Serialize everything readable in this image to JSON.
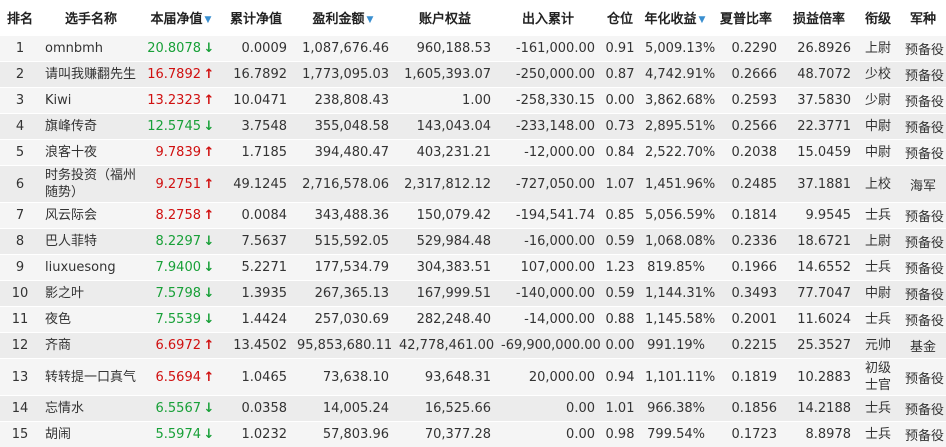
{
  "headers": [
    {
      "label": "排名",
      "sortable": false
    },
    {
      "label": "选手名称",
      "sortable": false
    },
    {
      "label": "本届净值",
      "sortable": true
    },
    {
      "label": "累计净值",
      "sortable": false
    },
    {
      "label": "盈利金额",
      "sortable": true
    },
    {
      "label": "账户权益",
      "sortable": false
    },
    {
      "label": "出入累计",
      "sortable": false
    },
    {
      "label": "仓位",
      "sortable": false
    },
    {
      "label": "年化收益",
      "sortable": true
    },
    {
      "label": "夏普比率",
      "sortable": false
    },
    {
      "label": "损益倍率",
      "sortable": false
    },
    {
      "label": "衔级",
      "sortable": false
    },
    {
      "label": "军种",
      "sortable": false
    }
  ],
  "sort_arrow_glyph": "▼",
  "colors": {
    "up": "#d01010",
    "down": "#18a038",
    "sort_arrow": "#3a8fd0"
  },
  "rows": [
    {
      "rank": "1",
      "name": "omnbmh",
      "nav": "20.8078",
      "dir": "down",
      "cum": "0.0009",
      "profit": "1,087,676.46",
      "equity": "960,188.53",
      "flow": "-161,000.00",
      "pos": "0.91",
      "annual": "5,009.13%",
      "sharpe": "0.2290",
      "pl": "26.8926",
      "rank_title": "上尉",
      "branch": "预备役"
    },
    {
      "rank": "2",
      "name": "请叫我赚翻先生",
      "nav": "16.7892",
      "dir": "up",
      "cum": "16.7892",
      "profit": "1,773,095.03",
      "equity": "1,605,393.07",
      "flow": "-250,000.00",
      "pos": "0.87",
      "annual": "4,742.91%",
      "sharpe": "0.2666",
      "pl": "48.7072",
      "rank_title": "少校",
      "branch": "预备役"
    },
    {
      "rank": "3",
      "name": "Kiwi",
      "nav": "13.2323",
      "dir": "up",
      "cum": "10.0471",
      "profit": "238,808.43",
      "equity": "1.00",
      "flow": "-258,330.15",
      "pos": "0.00",
      "annual": "3,862.68%",
      "sharpe": "0.2593",
      "pl": "37.5830",
      "rank_title": "少尉",
      "branch": "预备役"
    },
    {
      "rank": "4",
      "name": "旗峰传奇",
      "nav": "12.5745",
      "dir": "down",
      "cum": "3.7548",
      "profit": "355,048.58",
      "equity": "143,043.04",
      "flow": "-233,148.00",
      "pos": "0.73",
      "annual": "2,895.51%",
      "sharpe": "0.2566",
      "pl": "22.3771",
      "rank_title": "中尉",
      "branch": "预备役"
    },
    {
      "rank": "5",
      "name": "浪客十夜",
      "nav": "9.7839",
      "dir": "up",
      "cum": "1.7185",
      "profit": "394,480.47",
      "equity": "403,231.21",
      "flow": "-12,000.00",
      "pos": "0.84",
      "annual": "2,522.70%",
      "sharpe": "0.2038",
      "pl": "15.0459",
      "rank_title": "中尉",
      "branch": "预备役"
    },
    {
      "rank": "6",
      "name": "时务投资（福州随势）",
      "nav": "9.2751",
      "dir": "up",
      "cum": "49.1245",
      "profit": "2,716,578.06",
      "equity": "2,317,812.12",
      "flow": "-727,050.00",
      "pos": "1.07",
      "annual": "1,451.96%",
      "sharpe": "0.2485",
      "pl": "37.1881",
      "rank_title": "上校",
      "branch": "海军"
    },
    {
      "rank": "7",
      "name": "风云际会",
      "nav": "8.2758",
      "dir": "up",
      "cum": "0.0084",
      "profit": "343,488.36",
      "equity": "150,079.42",
      "flow": "-194,541.74",
      "pos": "0.85",
      "annual": "5,056.59%",
      "sharpe": "0.1814",
      "pl": "9.9545",
      "rank_title": "士兵",
      "branch": "预备役"
    },
    {
      "rank": "8",
      "name": "巴人菲特",
      "nav": "8.2297",
      "dir": "down",
      "cum": "7.5637",
      "profit": "515,592.05",
      "equity": "529,984.48",
      "flow": "-16,000.00",
      "pos": "0.59",
      "annual": "1,068.08%",
      "sharpe": "0.2336",
      "pl": "18.6721",
      "rank_title": "上尉",
      "branch": "预备役"
    },
    {
      "rank": "9",
      "name": "liuxuesong",
      "nav": "7.9400",
      "dir": "down",
      "cum": "5.2271",
      "profit": "177,534.79",
      "equity": "304,383.51",
      "flow": "107,000.00",
      "pos": "1.23",
      "annual": "819.85%",
      "sharpe": "0.1966",
      "pl": "14.6552",
      "rank_title": "士兵",
      "branch": "预备役"
    },
    {
      "rank": "10",
      "name": "影之叶",
      "nav": "7.5798",
      "dir": "down",
      "cum": "1.3935",
      "profit": "267,365.13",
      "equity": "167,999.51",
      "flow": "-140,000.00",
      "pos": "0.59",
      "annual": "1,144.31%",
      "sharpe": "0.3493",
      "pl": "77.7047",
      "rank_title": "中尉",
      "branch": "预备役"
    },
    {
      "rank": "11",
      "name": "夜色",
      "nav": "7.5539",
      "dir": "down",
      "cum": "1.4424",
      "profit": "257,030.69",
      "equity": "282,248.40",
      "flow": "-14,000.00",
      "pos": "0.88",
      "annual": "1,145.58%",
      "sharpe": "0.2001",
      "pl": "11.6024",
      "rank_title": "士兵",
      "branch": "预备役"
    },
    {
      "rank": "12",
      "name": "齐商",
      "nav": "6.6972",
      "dir": "up",
      "cum": "13.4502",
      "profit": "95,853,680.11",
      "equity": "42,778,461.00",
      "flow": "-69,900,000.00",
      "pos": "0.00",
      "annual": "991.19%",
      "sharpe": "0.2215",
      "pl": "25.3527",
      "rank_title": "元帅",
      "branch": "基金"
    },
    {
      "rank": "13",
      "name": "转转提一口真气",
      "nav": "6.5694",
      "dir": "up",
      "cum": "1.0465",
      "profit": "73,638.10",
      "equity": "93,648.31",
      "flow": "20,000.00",
      "pos": "0.94",
      "annual": "1,101.11%",
      "sharpe": "0.1819",
      "pl": "10.2883",
      "rank_title": "初级士官",
      "branch": "预备役"
    },
    {
      "rank": "14",
      "name": "忘情水",
      "nav": "6.5567",
      "dir": "down",
      "cum": "0.0358",
      "profit": "14,005.24",
      "equity": "16,525.66",
      "flow": "0.00",
      "pos": "1.01",
      "annual": "966.38%",
      "sharpe": "0.1856",
      "pl": "14.2188",
      "rank_title": "士兵",
      "branch": "预备役"
    },
    {
      "rank": "15",
      "name": "胡闹",
      "nav": "5.5974",
      "dir": "down",
      "cum": "1.0232",
      "profit": "57,803.96",
      "equity": "70,377.28",
      "flow": "0.00",
      "pos": "0.98",
      "annual": "799.54%",
      "sharpe": "0.1723",
      "pl": "8.8978",
      "rank_title": "士兵",
      "branch": "预备役"
    }
  ]
}
